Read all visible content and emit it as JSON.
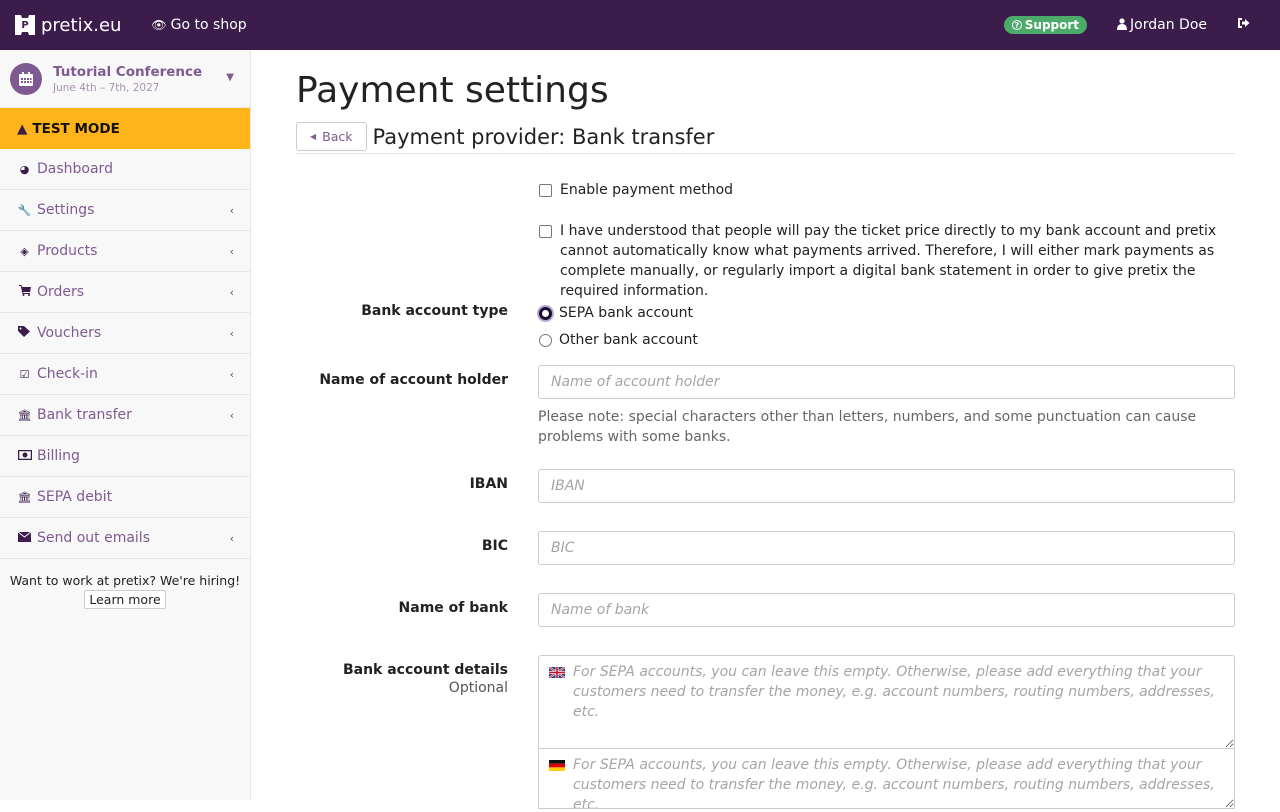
{
  "navbar": {
    "brand": "pretix.eu",
    "brand_logo_text": "P",
    "go_to_shop": "Go to shop",
    "support": "Support",
    "user": "Jordan Doe"
  },
  "sidebar": {
    "event": {
      "title": "Tutorial Conference",
      "date": "June 4th – 7th, 2027"
    },
    "test_mode": "TEST MODE",
    "items": [
      {
        "label": "Dashboard",
        "icon": "dashboard-icon",
        "submenu": false
      },
      {
        "label": "Settings",
        "icon": "wrench-icon",
        "submenu": true
      },
      {
        "label": "Products",
        "icon": "ticket-icon",
        "submenu": true
      },
      {
        "label": "Orders",
        "icon": "cart-icon",
        "submenu": true
      },
      {
        "label": "Vouchers",
        "icon": "tags-icon",
        "submenu": true
      },
      {
        "label": "Check-in",
        "icon": "check-square-icon",
        "submenu": true
      },
      {
        "label": "Bank transfer",
        "icon": "bank-icon",
        "submenu": true
      },
      {
        "label": "Billing",
        "icon": "money-icon",
        "submenu": false
      },
      {
        "label": "SEPA debit",
        "icon": "bank-icon",
        "submenu": false
      },
      {
        "label": "Send out emails",
        "icon": "envelope-icon",
        "submenu": true
      }
    ],
    "hiring_text": "Want to work at pretix? We're hiring!",
    "learn_more": "Learn more"
  },
  "main": {
    "title": "Payment settings",
    "back_label": "Back",
    "subtitle": "Payment provider: Bank transfer",
    "enable_label": "Enable payment method",
    "enable_checked": false,
    "ack_label": "I have understood that people will pay the ticket price directly to my bank account and pretix cannot automatically know what payments arrived. Therefore, I will either mark payments as complete manually, or regularly import a digital bank statement in order to give pretix the required information.",
    "ack_checked": false,
    "account_type": {
      "label": "Bank account type",
      "options": [
        "SEPA bank account",
        "Other bank account"
      ],
      "selected": "SEPA bank account"
    },
    "holder": {
      "label": "Name of account holder",
      "placeholder": "Name of account holder",
      "value": "",
      "help": "Please note: special characters other than letters, numbers, and some punctuation can cause problems with some banks."
    },
    "iban": {
      "label": "IBAN",
      "placeholder": "IBAN",
      "value": ""
    },
    "bic": {
      "label": "BIC",
      "placeholder": "BIC",
      "value": ""
    },
    "bank_name": {
      "label": "Name of bank",
      "placeholder": "Name of bank",
      "value": ""
    },
    "details": {
      "label": "Bank account details",
      "optional": "Optional",
      "placeholder_en": "For SEPA accounts, you can leave this empty. Otherwise, please add everything that your customers need to transfer the money, e.g. account numbers, routing numbers, addresses, etc.",
      "placeholder_de": "For SEPA accounts, you can leave this empty. Otherwise, please add everything that your customers need to transfer the money, e.g. account numbers, routing numbers, addresses, etc."
    }
  }
}
